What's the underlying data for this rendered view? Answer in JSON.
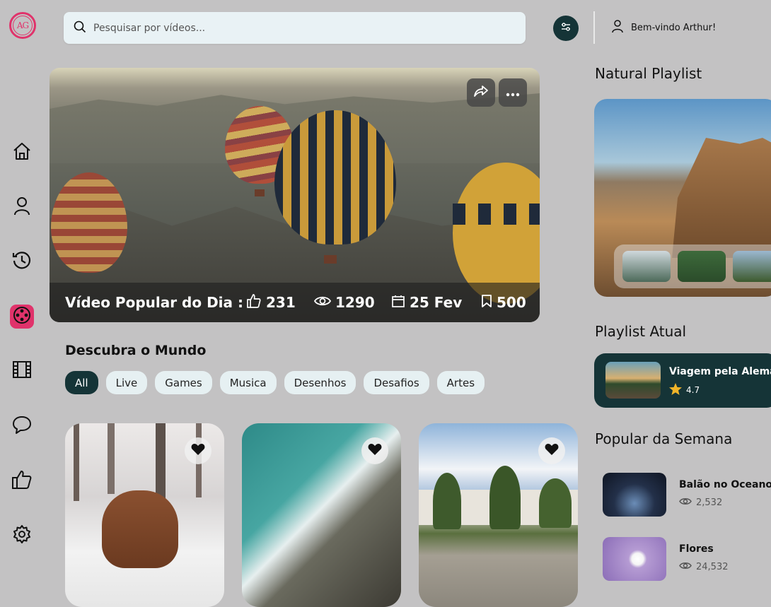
{
  "brand": {
    "logo_text": "AG",
    "accent": "#e0336b",
    "dark": "#153437"
  },
  "search": {
    "placeholder": "Pesquisar por vídeos...",
    "icon": "search-icon"
  },
  "header": {
    "filter_icon": "sliders-icon",
    "user_icon": "user-icon",
    "welcome": "Bem-vindo Arthur!"
  },
  "sidebar": {
    "items": [
      {
        "name": "home",
        "icon": "home-icon",
        "active": false
      },
      {
        "name": "profile",
        "icon": "user-icon",
        "active": false
      },
      {
        "name": "history",
        "icon": "history-icon",
        "active": false
      },
      {
        "name": "reels",
        "icon": "film-reel-icon",
        "active": true
      },
      {
        "name": "films",
        "icon": "film-strip-icon",
        "active": false
      },
      {
        "name": "chat",
        "icon": "chat-icon",
        "active": false
      },
      {
        "name": "likes",
        "icon": "thumbs-up-icon",
        "active": false
      },
      {
        "name": "settings",
        "icon": "gear-icon",
        "active": false
      }
    ]
  },
  "hero": {
    "label": "Vídeo Popular do Dia :",
    "likes": "231",
    "views": "1290",
    "date": "25 Fev",
    "saves": "500",
    "share_icon": "share-icon",
    "more_icon": "more-icon"
  },
  "discover": {
    "title": "Descubra o Mundo",
    "chips": [
      "All",
      "Live",
      "Games",
      "Musica",
      "Desenhos",
      "Desafios",
      "Artes"
    ],
    "active_chip": "All"
  },
  "cards": [
    {
      "subject": "highland-cow-snow",
      "icon": "heart-icon"
    },
    {
      "subject": "ocean-waves-aerial",
      "icon": "heart-icon"
    },
    {
      "subject": "palm-town-square",
      "icon": "heart-icon"
    }
  ],
  "right": {
    "natural_title": "Natural Playlist",
    "current_title": "Playlist Atual",
    "current": {
      "name": "Viagem pela Alemanha",
      "rating": "4.7",
      "star_icon": "star-icon"
    },
    "popular_title": "Popular da Semana",
    "popular": [
      {
        "name": "Balão no Oceano",
        "views": "2,532"
      },
      {
        "name": "Flores",
        "views": "24,532"
      }
    ]
  }
}
